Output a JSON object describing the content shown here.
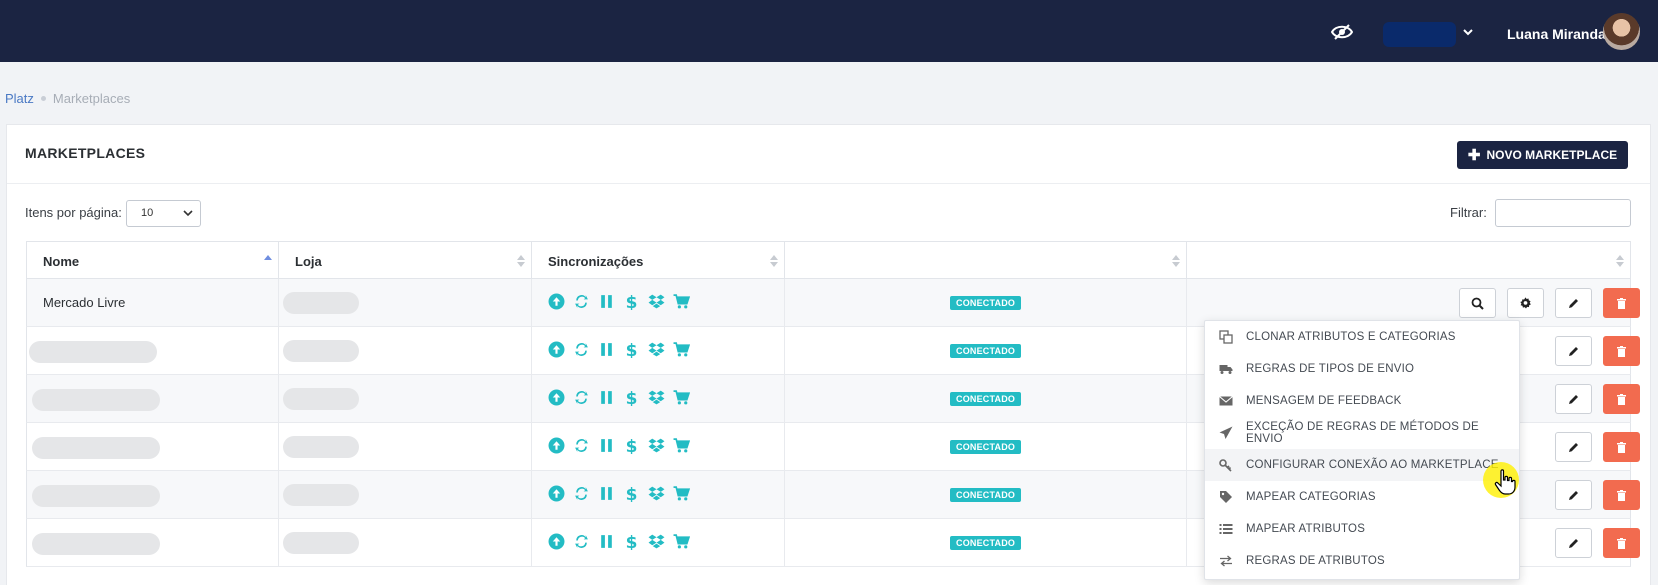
{
  "header": {
    "user_name": "Luana Miranda"
  },
  "breadcrumb": {
    "root": "Platz",
    "current": "Marketplaces"
  },
  "card": {
    "title": "MARKETPLACES",
    "new_button": "NOVO MARKETPLACE"
  },
  "controls": {
    "items_per_page_label": "Itens por página:",
    "items_per_page_value": "10",
    "filter_label": "Filtrar:"
  },
  "table": {
    "columns": [
      "Nome",
      "Loja",
      "Sincronizações",
      "",
      ""
    ],
    "rows": [
      {
        "name": "Mercado Livre",
        "status": "CONECTADO"
      },
      {
        "name": "",
        "status": "CONECTADO"
      },
      {
        "name": "",
        "status": "CONECTADO"
      },
      {
        "name": "",
        "status": "CONECTADO"
      },
      {
        "name": "",
        "status": "CONECTADO"
      },
      {
        "name": "",
        "status": "CONECTADO"
      }
    ]
  },
  "menu": {
    "items": [
      {
        "label": "CLONAR ATRIBUTOS E CATEGORIAS",
        "icon": "copy-icon"
      },
      {
        "label": "REGRAS DE TIPOS DE ENVIO",
        "icon": "truck-icon"
      },
      {
        "label": "MENSAGEM DE FEEDBACK",
        "icon": "envelope-icon"
      },
      {
        "label": "EXCEÇÃO DE REGRAS DE MÉTODOS DE ENVIO",
        "icon": "paper-plane-icon"
      },
      {
        "label": "CONFIGURAR CONEXÃO AO MARKETPLACE",
        "icon": "key-icon"
      },
      {
        "label": "MAPEAR CATEGORIAS",
        "icon": "tag-icon"
      },
      {
        "label": "MAPEAR ATRIBUTOS",
        "icon": "list-icon"
      },
      {
        "label": "REGRAS DE ATRIBUTOS",
        "icon": "exchange-icon"
      }
    ]
  },
  "colors": {
    "navbar": "#1b2442",
    "accent": "#23bcc4",
    "danger": "#f26b4f",
    "store_select": "#0a2a6b"
  }
}
